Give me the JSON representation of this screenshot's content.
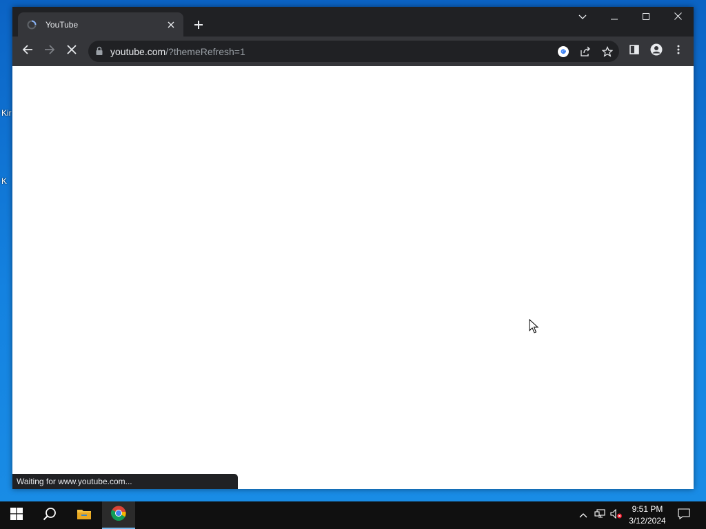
{
  "desktop": {
    "fragments": [
      "Kir",
      "",
      "K"
    ]
  },
  "browser": {
    "tab": {
      "title": "YouTube",
      "favicon": "loading-spinner-icon"
    },
    "omnibox": {
      "host": "youtube.com",
      "path": "/?themeRefresh=1"
    },
    "status": "Waiting for www.youtube.com...",
    "toolbar_icons": [
      "back-arrow-icon",
      "forward-arrow-icon",
      "stop-loading-icon",
      "google-icon",
      "share-icon",
      "bookmark-star-icon",
      "side-panel-icon",
      "profile-icon",
      "kebab-menu-icon"
    ],
    "colors": {
      "frame": "#202124",
      "toolbar": "#35363a",
      "text": "#e8eaed",
      "muted": "#9aa0a6"
    }
  },
  "taskbar": {
    "time": "9:51 PM",
    "date": "3/12/2024",
    "pinned": [
      "windows-start-icon",
      "search-icon",
      "file-explorer-icon",
      "chrome-icon"
    ],
    "tray": [
      "chevron-up-icon",
      "network-icon",
      "volume-muted-icon",
      "notification-icon"
    ]
  },
  "desktop_background": "#1482e0"
}
